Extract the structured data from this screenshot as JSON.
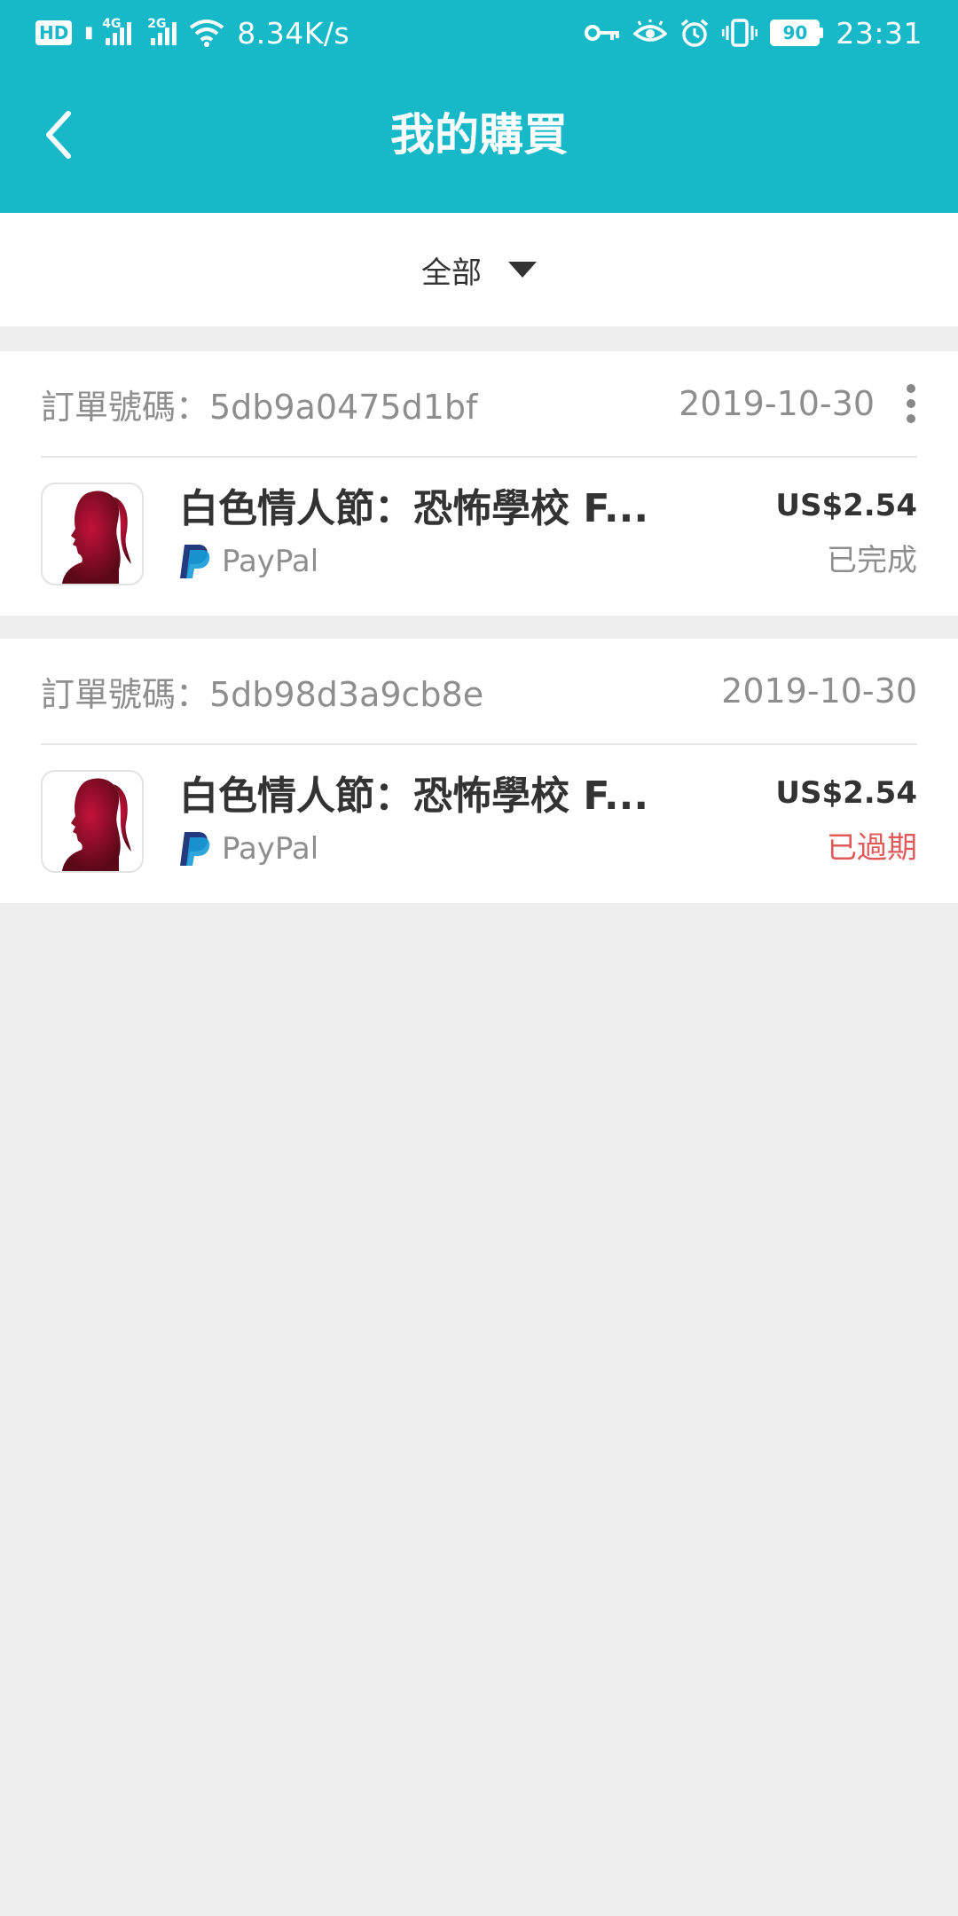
{
  "status_bar": {
    "hd_label": "HD",
    "sim1_network": "4G",
    "sim2_network": "2G",
    "speed": "8.34K/s",
    "battery": "90",
    "time": "23:31"
  },
  "header": {
    "title": "我的購買"
  },
  "filter": {
    "selected": "全部"
  },
  "orders": [
    {
      "order_number": "訂單號碼：5db9a0475d1bf",
      "date": "2019-10-30",
      "item_title": "白色情人節：恐怖學校 F...",
      "payment_method": "PayPal",
      "price": "US$2.54",
      "status": "已完成",
      "status_color": "#8e8e8e"
    },
    {
      "order_number": "訂單號碼：5db98d3a9cb8e",
      "date": "2019-10-30",
      "item_title": "白色情人節：恐怖學校 F...",
      "payment_method": "PayPal",
      "price": "US$2.54",
      "status": "已過期",
      "status_color": "#e05a5a"
    }
  ],
  "colors": {
    "accent": "#17b8c8",
    "background": "#eeeeee",
    "expired": "#e05a5a"
  }
}
